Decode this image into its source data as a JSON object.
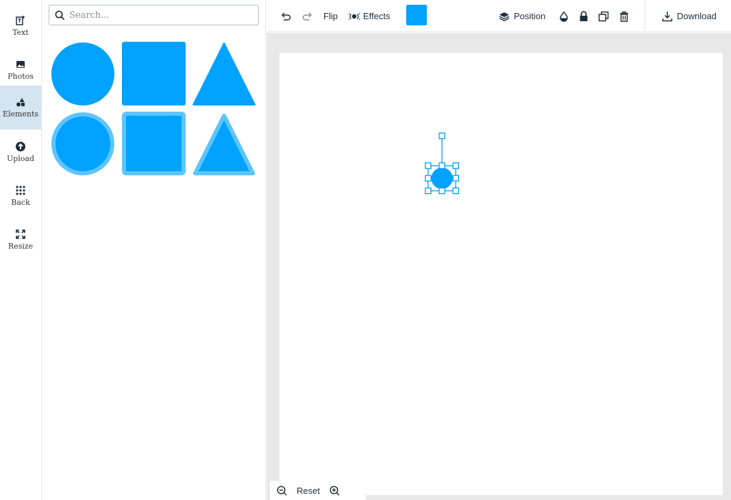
{
  "sidebar": {
    "items": [
      {
        "label": "Text",
        "icon": "text-add-icon"
      },
      {
        "label": "Photos",
        "icon": "photo-icon"
      },
      {
        "label": "Elements",
        "icon": "shapes-icon",
        "active": true
      },
      {
        "label": "Upload",
        "icon": "upload-icon"
      },
      {
        "label": "Back",
        "icon": "grid-dots-icon"
      },
      {
        "label": "Resize",
        "icon": "resize-icon"
      }
    ]
  },
  "panel": {
    "search_placeholder": "Search...",
    "shapes": [
      "circle",
      "square",
      "triangle",
      "circle-outlined",
      "square-outlined",
      "triangle-outlined"
    ]
  },
  "toolbar": {
    "flip_label": "Flip",
    "effects_label": "Effects",
    "position_label": "Position",
    "download_label": "Download",
    "fill_color": "#00a2ff"
  },
  "zoom": {
    "reset_label": "Reset"
  },
  "colors": {
    "shape_fill": "#00a2ff",
    "shape_stroke": "#5ec4ff",
    "active_bg": "#d4e5f1",
    "workspace_bg": "#e8e8e8"
  }
}
